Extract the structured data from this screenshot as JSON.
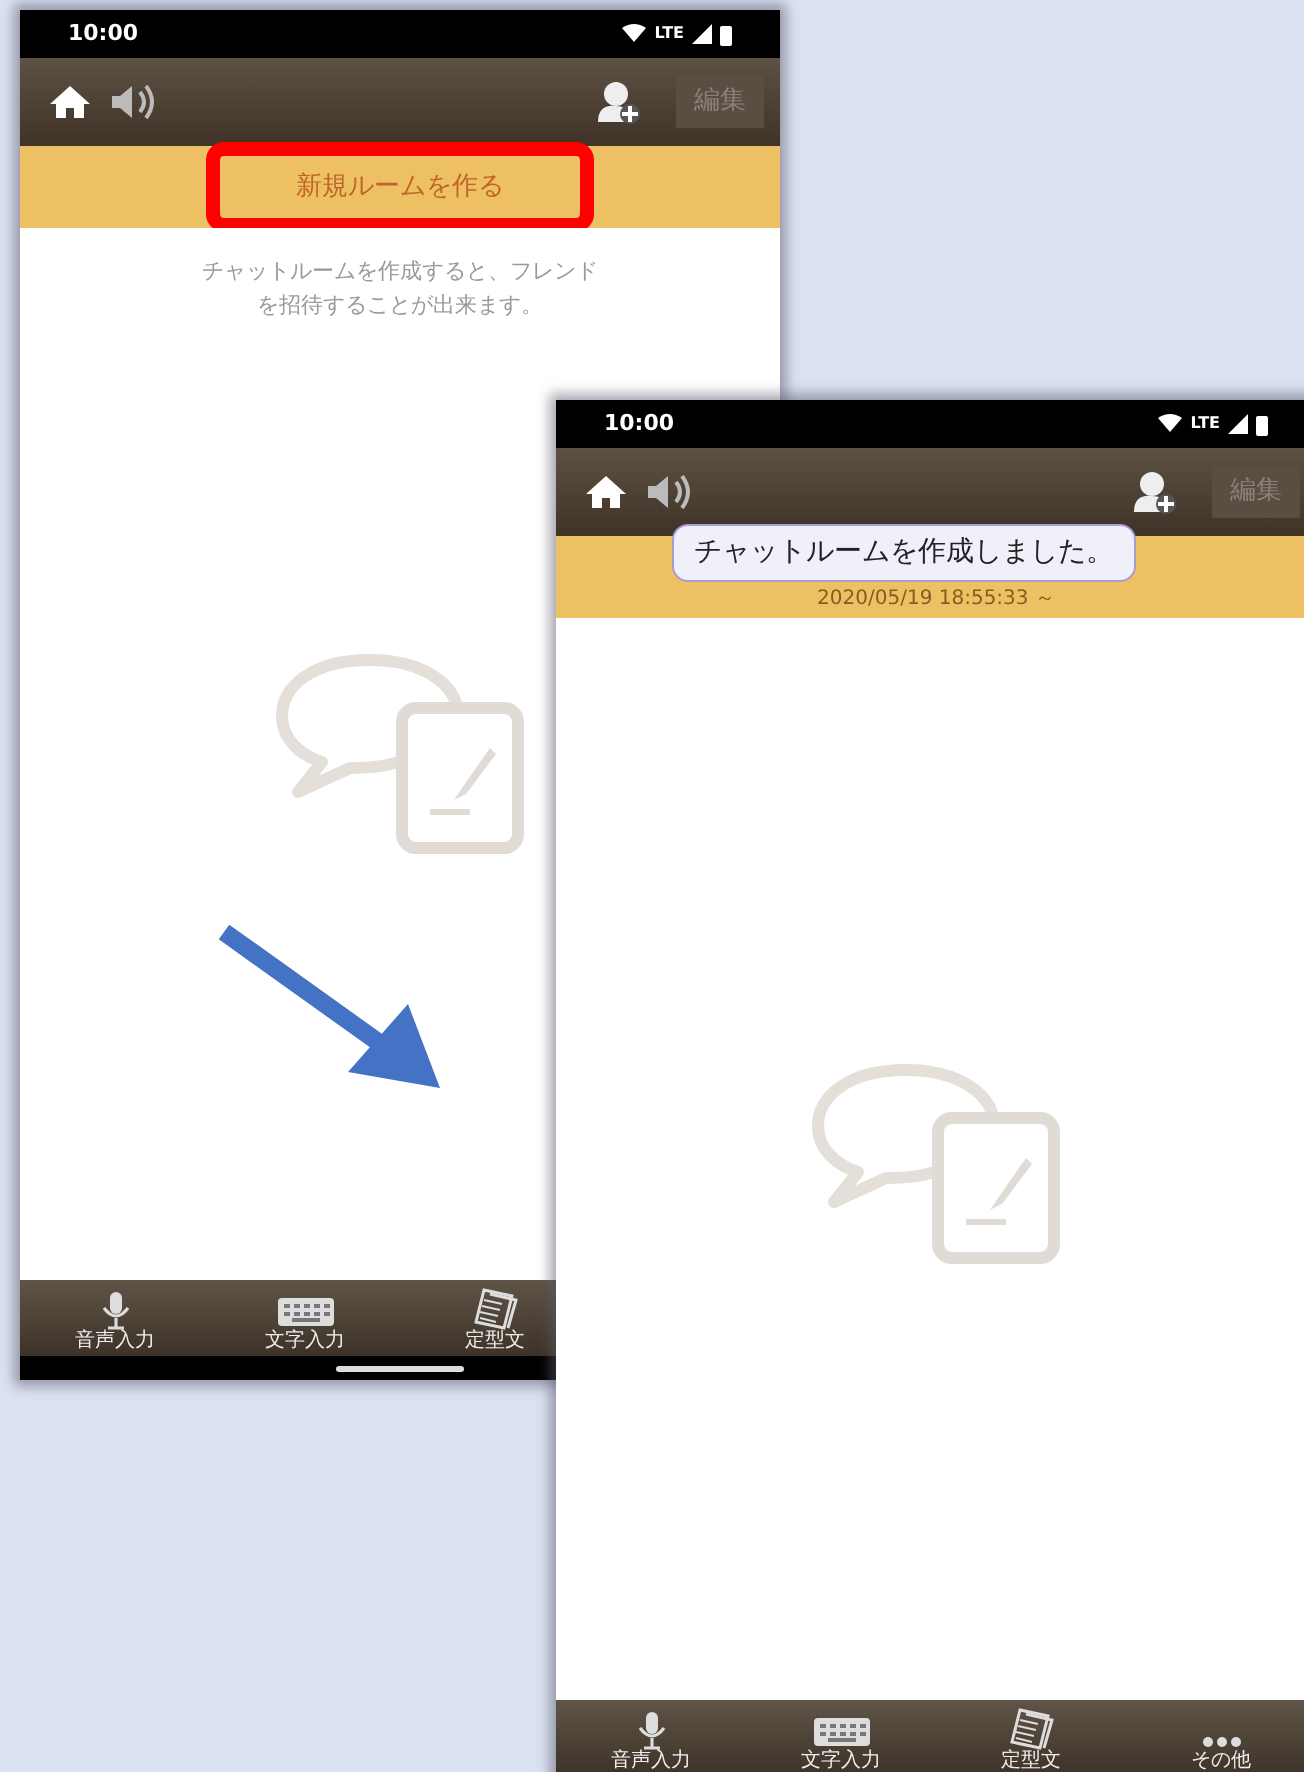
{
  "screens": [
    {
      "status_bar": {
        "time": "10:00",
        "network": "LTE"
      },
      "app_bar": {
        "edit_button": "編集"
      },
      "create_room_button": {
        "label": "新規ルームを作る",
        "highlighted": true
      },
      "description": "チャットルームを作成すると、フレンドを招待することが出来ます。",
      "toolbar": [
        {
          "kind": "mic",
          "label": "音声入力"
        },
        {
          "kind": "keyboard",
          "label": "文字入力"
        },
        {
          "kind": "templates",
          "label": "定型文"
        }
      ]
    },
    {
      "status_bar": {
        "time": "10:00",
        "network": "LTE"
      },
      "app_bar": {
        "edit_button": "編集"
      },
      "toast": "チャットルームを作成しました。",
      "created_at": "2020/05/19 18:55:33 ～",
      "toolbar": [
        {
          "kind": "mic",
          "label": "音声入力"
        },
        {
          "kind": "keyboard",
          "label": "文字入力"
        },
        {
          "kind": "templates",
          "label": "定型文"
        },
        {
          "kind": "more",
          "label": "その他"
        }
      ]
    }
  ]
}
